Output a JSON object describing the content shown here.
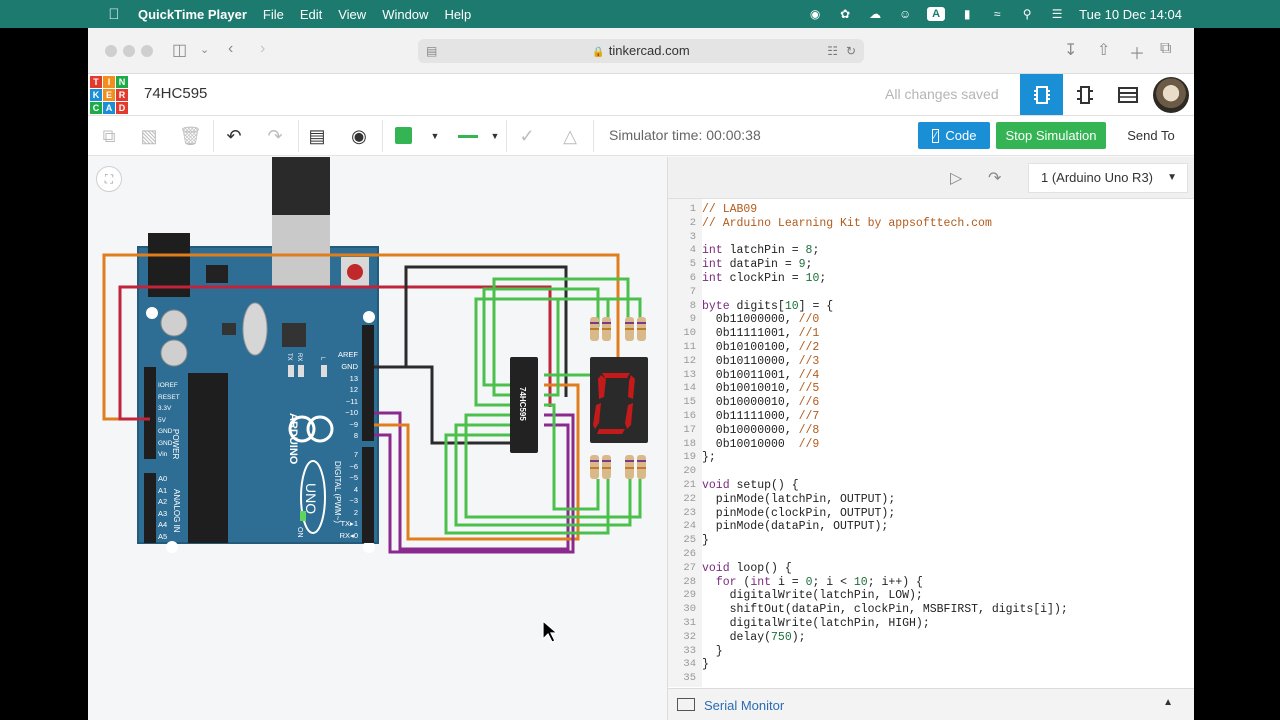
{
  "menubar": {
    "app_name": "QuickTime Player",
    "menus": [
      "File",
      "Edit",
      "View",
      "Window",
      "Help"
    ],
    "input_indicator": "A",
    "datetime": "Tue 10 Dec  14:04"
  },
  "browser": {
    "url": "tinkercad.com"
  },
  "header": {
    "logo_letters": [
      "TIN",
      "KER",
      "CAD"
    ],
    "project_name": "74HC595",
    "save_status": "All changes saved"
  },
  "toolbar": {
    "simulator_time": "Simulator time: 00:00:38",
    "code_label": "Code",
    "stop_label": "Stop Simulation",
    "send_label": "Send To"
  },
  "circuit": {
    "board_brand": "ARDUINO",
    "board_model": "UNO",
    "chip_label": "74HC595",
    "power_label": "POWER",
    "analog_label": "ANALOG IN",
    "digital_label": "DIGITAL (PWM~)",
    "on_label": "ON",
    "display_digit": "0",
    "pins_power": [
      "IOREF",
      "RESET",
      "3.3V",
      "5V",
      "GND",
      "GND",
      "Vin"
    ],
    "pins_analog": [
      "A0",
      "A1",
      "A2",
      "A3",
      "A4",
      "A5"
    ],
    "pins_digital_top": [
      "AREF",
      "GND",
      "13",
      "12",
      "~11",
      "~10",
      "~9",
      "8"
    ],
    "pins_digital_bottom": [
      "7",
      "~6",
      "~5",
      "4",
      "~3",
      "2",
      "TX▸1",
      "RX◂0"
    ],
    "led_labels": [
      "TX",
      "RX",
      "L"
    ]
  },
  "code_panel": {
    "device": "1 (Arduino Uno R3)",
    "serial_monitor": "Serial Monitor",
    "lines": [
      "// LAB09",
      "// Arduino Learning Kit by appsofttech.com",
      "",
      "int latchPin = 8;",
      "int dataPin = 9;",
      "int clockPin = 10;",
      "",
      "byte digits[10] = {",
      "  0b11000000, //0",
      "  0b11111001, //1",
      "  0b10100100, //2",
      "  0b10110000, //3",
      "  0b10011001, //4",
      "  0b10010010, //5",
      "  0b10000010, //6",
      "  0b11111000, //7",
      "  0b10000000, //8",
      "  0b10010000  //9",
      "};",
      "",
      "void setup() {",
      "  pinMode(latchPin, OUTPUT);",
      "  pinMode(clockPin, OUTPUT);",
      "  pinMode(dataPin, OUTPUT);",
      "}",
      "",
      "void loop() {",
      "  for (int i = 0; i < 10; i++) {",
      "    digitalWrite(latchPin, LOW);",
      "    shiftOut(dataPin, clockPin, MSBFIRST, digits[i]);",
      "    digitalWrite(latchPin, HIGH);",
      "    delay(750);",
      "  }",
      "}",
      ""
    ]
  },
  "colors": {
    "menubar": "#1d7a6e",
    "accent_blue": "#1a8fd6",
    "stop_green": "#35b454",
    "board_blue": "#2f6e94",
    "segment_red": "#c41a1a",
    "wire_green": "#4cc04c",
    "wire_orange": "#e07d1c",
    "wire_red": "#c0233a",
    "wire_purple": "#8a2a8f",
    "wire_black": "#2b2b2b"
  }
}
